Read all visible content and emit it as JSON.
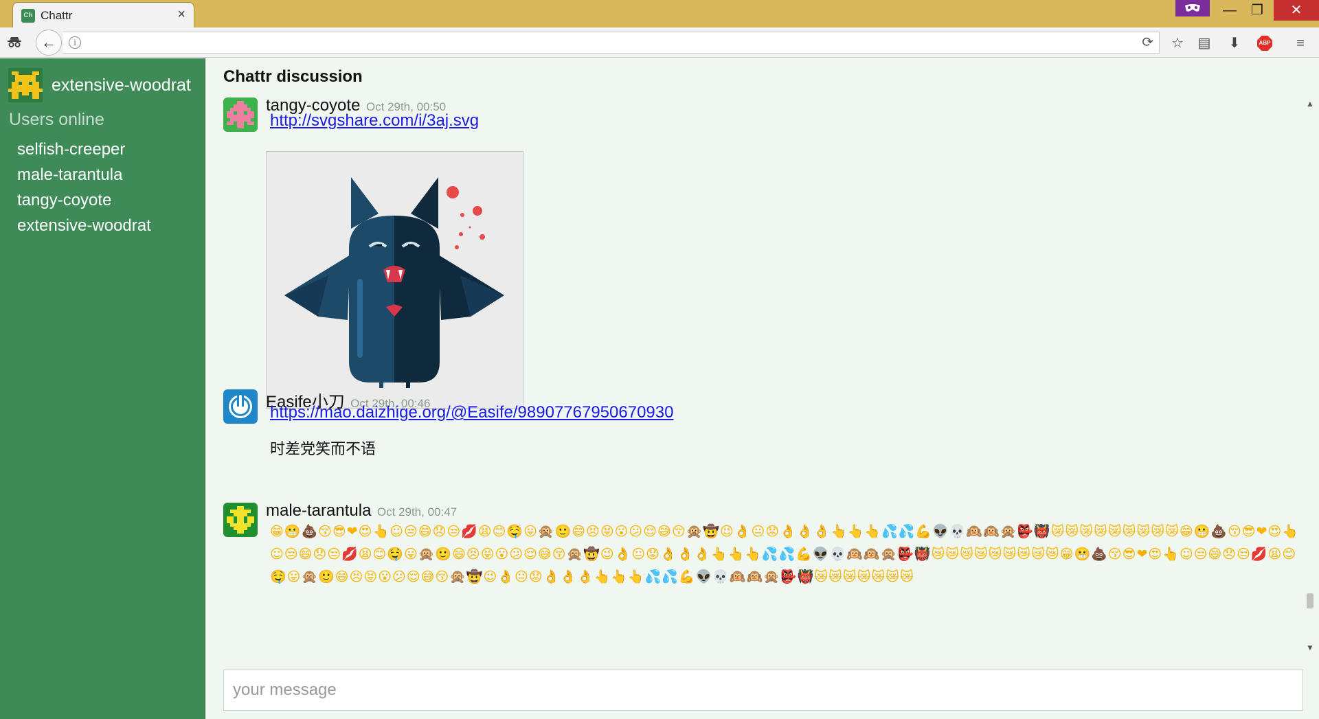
{
  "browser": {
    "tab_title": "Chattr",
    "tab_favicon_text": "Ch",
    "address_value": "",
    "colors": {
      "titlebar": "#d9b85c",
      "incognito": "#7b2e9b",
      "close": "#c62f2f"
    }
  },
  "sidebar": {
    "current_user": "extensive-woodrat",
    "users_heading": "Users online",
    "users": [
      "selfish-creeper",
      "male-tarantula",
      "tangy-coyote",
      "extensive-woodrat"
    ],
    "color": "#3e8b58"
  },
  "chat": {
    "title": "Chattr discussion",
    "messages": [
      {
        "author": "tangy-coyote",
        "time": "Oct 29th, 00:50",
        "link": "http://svgshare.com/i/3aj.svg",
        "embed": "bat-illustration"
      },
      {
        "author": "Easife小刀",
        "time": "Oct 29th, 00:46",
        "link": "https://mao.daizhige.org/@Easife/98907767950670930",
        "text": "时差党笑而不语"
      },
      {
        "author": "male-tarantula",
        "time": "Oct 29th, 00:47",
        "emoji_text": "😁😬💩😚😎❤😍👆☺😒😄😞😒💋😫😊🤤😛🙊🙂😄😣😝😮😕😌😅😚🙊🤠😉👌😐😟👌👌👌👆👆👆💦💦💪👽💀🙉🙉🙊👺👹😿😿😿😿😿😿😿😿😿😁😬💩😚😎❤😍👆☺😒😄😞😒💋😫😊🤤😛🙊🙂😄😣😝😮😕😌😅😚🙊🤠😉👌😐😟👌👌👌👆👆👆💦💦💪👽💀🙉🙉🙊👺👹😿😿😿😿😿😿😿😿😿😁😬💩😚😎❤😍👆☺😒😄😞😒💋😫😊🤤😛🙊🙂😄😣😝😮😕😌😅😚🙊🤠😉👌😐😟👌👌👌👆👆👆💦💦💪👽💀🙉🙉🙊👺👹😿😿😿😿😿😿😿"
      }
    ]
  },
  "composer": {
    "placeholder": "your message",
    "value": ""
  }
}
